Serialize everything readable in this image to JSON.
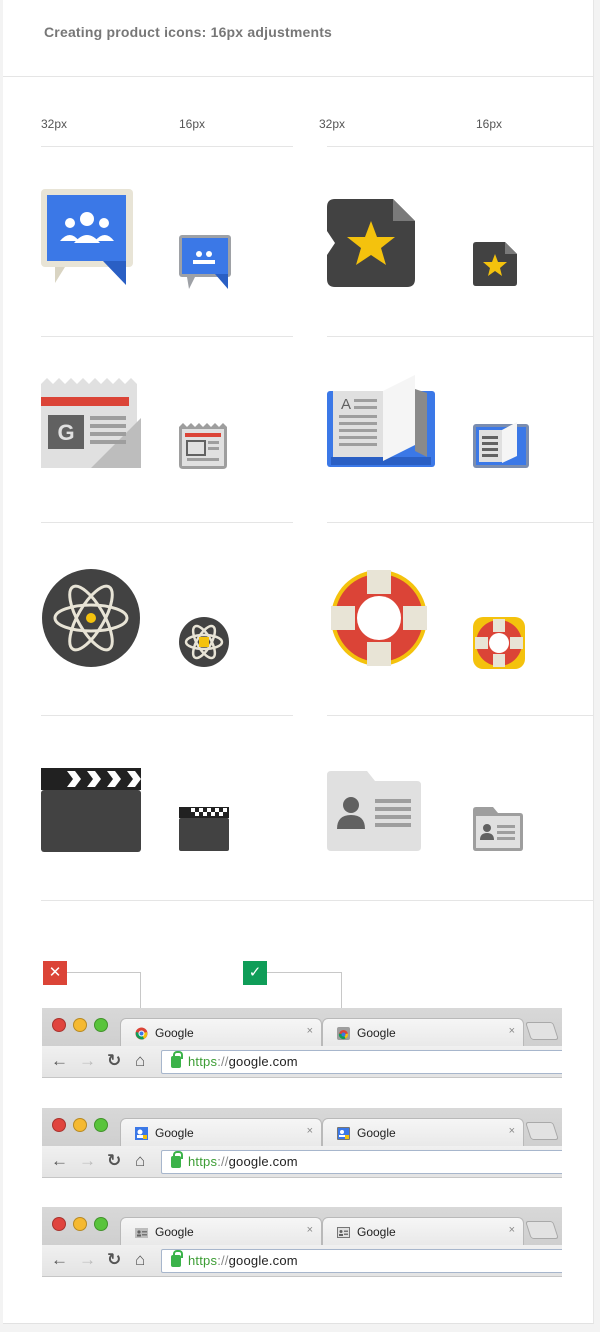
{
  "page": {
    "title": "Creating product icons: 16px adjustments"
  },
  "columns": [
    "32px",
    "16px",
    "32px",
    "16px"
  ],
  "icon_rows": [
    {
      "left": {
        "name": "classroom-icon",
        "color": "#3b78e7"
      },
      "right": {
        "name": "star-document-icon",
        "color": "#f4c20d"
      }
    },
    {
      "left": {
        "name": "newspaper-icon",
        "color": "#db4437"
      },
      "right": {
        "name": "open-book-icon",
        "color": "#3b78e7"
      }
    },
    {
      "left": {
        "name": "atom-icon",
        "color": "#f4c20d"
      },
      "right": {
        "name": "lifebuoy-icon",
        "color": "#db4437"
      }
    },
    {
      "left": {
        "name": "clapperboard-icon",
        "color": "#424242"
      },
      "right": {
        "name": "contact-folder-icon",
        "color": "#9e9e9e"
      }
    }
  ],
  "comparison": {
    "bad_marker": "✕",
    "good_marker": "✓",
    "bad_color": "#db4437",
    "good_color": "#0f9d58"
  },
  "browser_rows": [
    {
      "tabs": [
        {
          "label": "Google",
          "close": "×",
          "favicon": "chrome-logo-icon"
        },
        {
          "label": "Google",
          "close": "×",
          "favicon": "chrome-logo-icon"
        }
      ],
      "url": {
        "scheme": "https",
        "separator": "://",
        "host": "google.com"
      }
    },
    {
      "tabs": [
        {
          "label": "Google",
          "close": "×",
          "favicon": "contacts-favicon-icon"
        },
        {
          "label": "Google",
          "close": "×",
          "favicon": "contacts-favicon-icon"
        }
      ],
      "url": {
        "scheme": "https",
        "separator": "://",
        "host": "google.com"
      }
    },
    {
      "tabs": [
        {
          "label": "Google",
          "close": "×",
          "favicon": "id-card-favicon-icon"
        },
        {
          "label": "Google",
          "close": "×",
          "favicon": "id-card-favicon-icon"
        }
      ],
      "url": {
        "scheme": "https",
        "separator": "://",
        "host": "google.com"
      }
    }
  ]
}
